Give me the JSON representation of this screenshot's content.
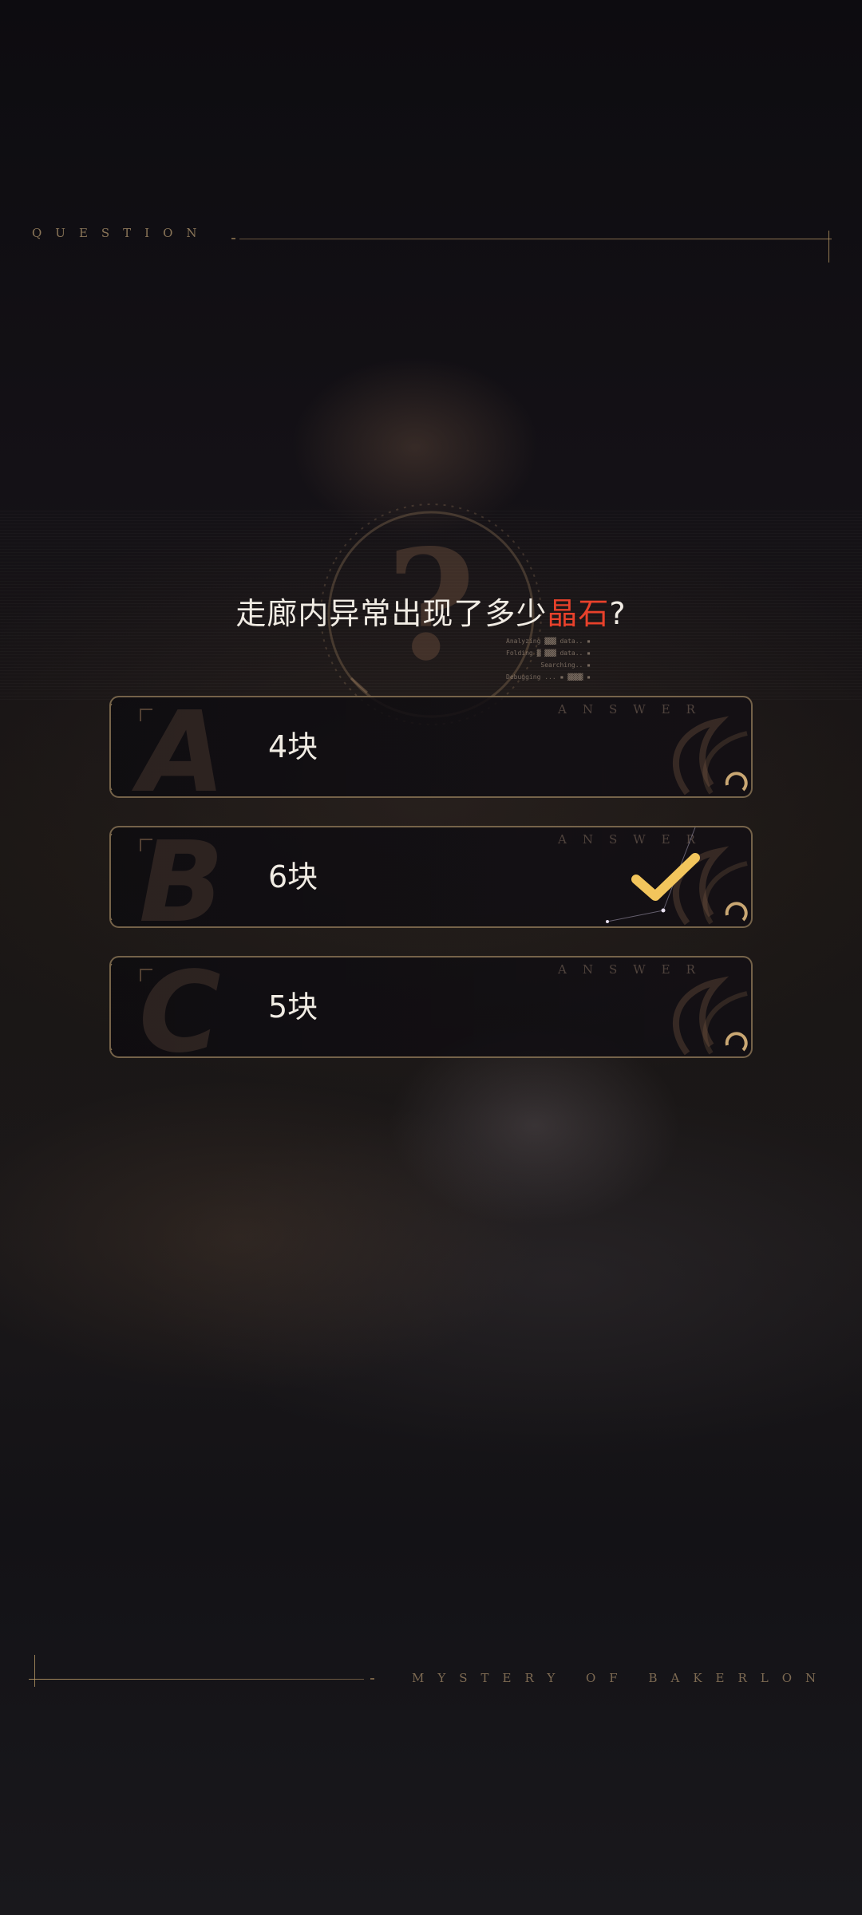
{
  "header": {
    "label": "QUESTION"
  },
  "question": {
    "text_before": "走廊内异常出现了多少",
    "highlight": "晶石",
    "text_after": "?"
  },
  "log_lines": [
    "Analyzing ▓▓▓ data.. ▪",
    "Folding ▓ ▓▓▓ data.. ▪",
    "Searching.. ▪",
    "Debugging ... ▪ ▓▓▓▓ ▪"
  ],
  "answers": [
    {
      "letter": "A",
      "label": "4块",
      "tag": "ANSWER",
      "selected": false
    },
    {
      "letter": "B",
      "label": "6块",
      "tag": "ANSWER",
      "selected": true
    },
    {
      "letter": "C",
      "label": "5块",
      "tag": "ANSWER",
      "selected": false
    }
  ],
  "footer": {
    "title": "MYSTERY OF BAKERLON"
  },
  "colors": {
    "accent_gold": "#d6b57a",
    "highlight_red": "#e8412b",
    "check_yellow": "#f2c55c"
  }
}
